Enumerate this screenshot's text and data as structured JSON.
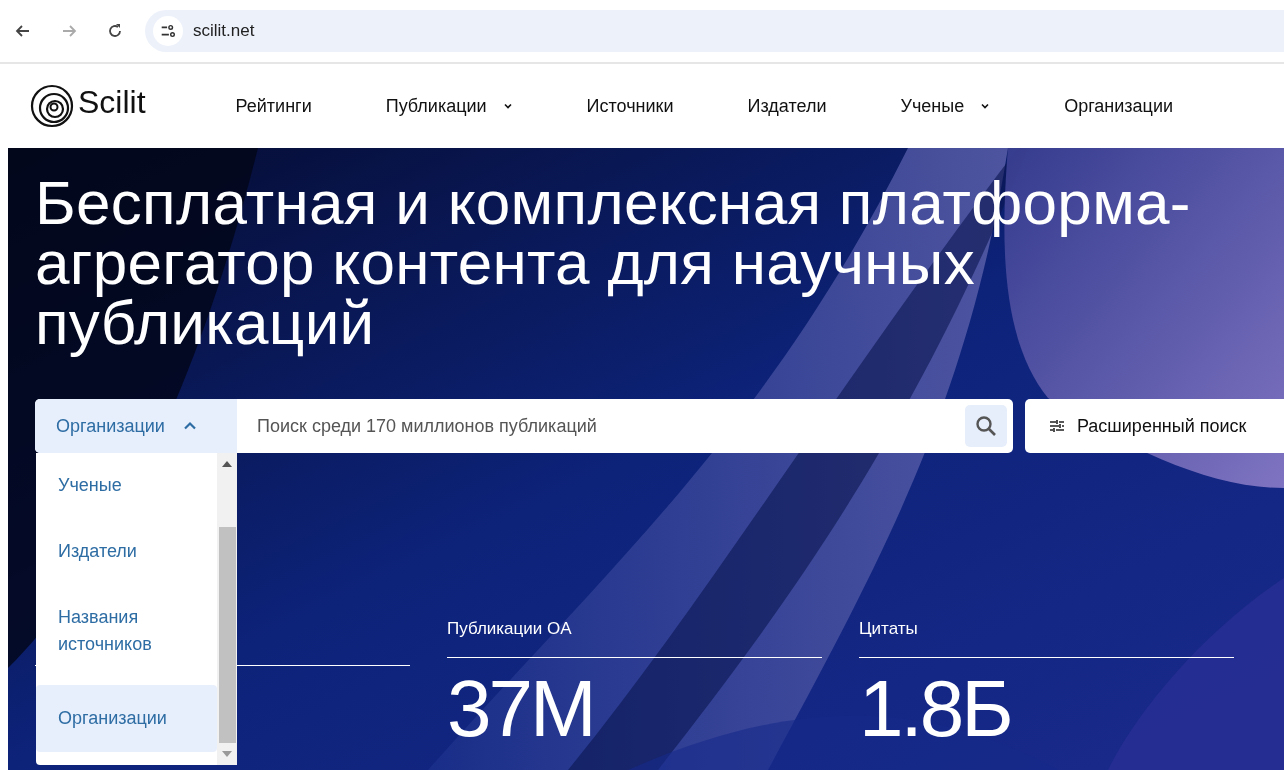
{
  "browser": {
    "url": "scilit.net"
  },
  "nav": {
    "logo": "Scilit",
    "items": [
      {
        "label": "Рейтинги",
        "dropdown": false
      },
      {
        "label": "Публикации",
        "dropdown": true
      },
      {
        "label": "Источники",
        "dropdown": false
      },
      {
        "label": "Издатели",
        "dropdown": false
      },
      {
        "label": "Ученые",
        "dropdown": true
      },
      {
        "label": "Организации",
        "dropdown": false
      }
    ]
  },
  "hero": {
    "title": "Бесплатная и комплексная платформа-агрегатор контента для научных публикаций"
  },
  "search": {
    "scope": {
      "label": "Организации",
      "expanded": true
    },
    "placeholder": "Поиск среди 170 миллионов публикаций",
    "options": [
      {
        "label": "Ученые",
        "selected": false
      },
      {
        "label": "Издатели",
        "selected": false
      },
      {
        "label": "Названия источников",
        "selected": false
      },
      {
        "label": "Организации",
        "selected": true
      }
    ],
    "advanced": "Расширенный поиск"
  },
  "stats": [
    {
      "label": "Публикации OA",
      "value": "37M"
    },
    {
      "label": "Цитаты",
      "value": "1.8Б"
    }
  ]
}
